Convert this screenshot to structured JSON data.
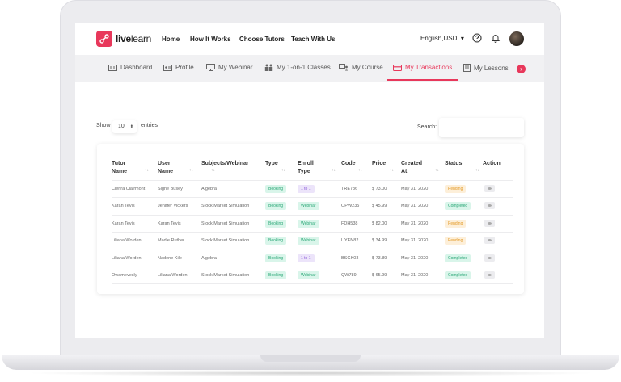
{
  "brand": {
    "name_bold": "live",
    "name_rest": "learn",
    "color": "#e8385b"
  },
  "topnav": {
    "links": [
      "Home",
      "How It Works",
      "Choose Tutors",
      "Teach With Us"
    ],
    "language": "English,USD",
    "language_caret": "▾"
  },
  "subnav": {
    "tabs": [
      {
        "label": "Dashboard",
        "icon": "dashboard-icon"
      },
      {
        "label": "Profile",
        "icon": "profile-card-icon"
      },
      {
        "label": "My Webinar",
        "icon": "monitor-icon"
      },
      {
        "label": "My 1-on-1 Classes",
        "icon": "people-icon"
      },
      {
        "label": "My Course",
        "icon": "course-icon"
      },
      {
        "label": "My Transactions",
        "icon": "credit-card-icon",
        "active": true
      },
      {
        "label": "My Lessons",
        "icon": "book-icon"
      }
    ],
    "next_arrow": "›"
  },
  "table_controls": {
    "show_label": "Show",
    "entries_value": "10",
    "entries_caret": "⬍",
    "entries_label": "entries",
    "search_label": "Search:"
  },
  "table": {
    "headers": [
      {
        "l1": "Tutor",
        "l2": "Name"
      },
      {
        "l1": "User",
        "l2": "Name"
      },
      {
        "l1": "",
        "l2": "Subjects/Webinar"
      },
      {
        "l1": "",
        "l2": "Type"
      },
      {
        "l1": "Enroll",
        "l2": "Type"
      },
      {
        "l1": "",
        "l2": "Code"
      },
      {
        "l1": "",
        "l2": "Price"
      },
      {
        "l1": "Created",
        "l2": "At"
      },
      {
        "l1": "",
        "l2": "Status"
      },
      {
        "l1": "",
        "l2": "Action"
      }
    ],
    "sort_glyph": "↑↓",
    "rows": [
      {
        "tutor": "Clenra Clairmont",
        "user": "Signe Busey",
        "subject": "Algebra",
        "type": "Booking",
        "enroll": "1 to 1",
        "code": "TRE736",
        "price": "$ 73.00",
        "created": "May 31, 2020",
        "status": "Pending"
      },
      {
        "tutor": "Karan Tevis",
        "user": "Jeniffer Vickers",
        "subject": "Stock Market Simulation",
        "type": "Booking",
        "enroll": "Webinar",
        "code": "OPW235",
        "price": "$ 45.99",
        "created": "May 31, 2020",
        "status": "Completed"
      },
      {
        "tutor": "Karan Tevis",
        "user": "Karan Tevis",
        "subject": "Stock Market Simulation",
        "type": "Booking",
        "enroll": "Webinar",
        "code": "FDH538",
        "price": "$ 82.00",
        "created": "May 31, 2020",
        "status": "Pending"
      },
      {
        "tutor": "Liliana Worden",
        "user": "Madie Ruther",
        "subject": "Stock Market Simulation",
        "type": "Booking",
        "enroll": "Webinar",
        "code": "UYEN82",
        "price": "$ 34.99",
        "created": "May 31, 2020",
        "status": "Pending"
      },
      {
        "tutor": "Liliana Worden",
        "user": "Nadene Kile",
        "subject": "Algebra",
        "type": "Booking",
        "enroll": "1 to 1",
        "code": "BSGK03",
        "price": "$ 73.89",
        "created": "May 31, 2020",
        "status": "Completed"
      },
      {
        "tutor": "Owamevesly",
        "user": "Liliana Worden",
        "subject": "Stock Market Simulation",
        "type": "Booking",
        "enroll": "Webinar",
        "code": "QW789",
        "price": "$ 65.99",
        "created": "May 31, 2020",
        "status": "Completed"
      }
    ]
  }
}
